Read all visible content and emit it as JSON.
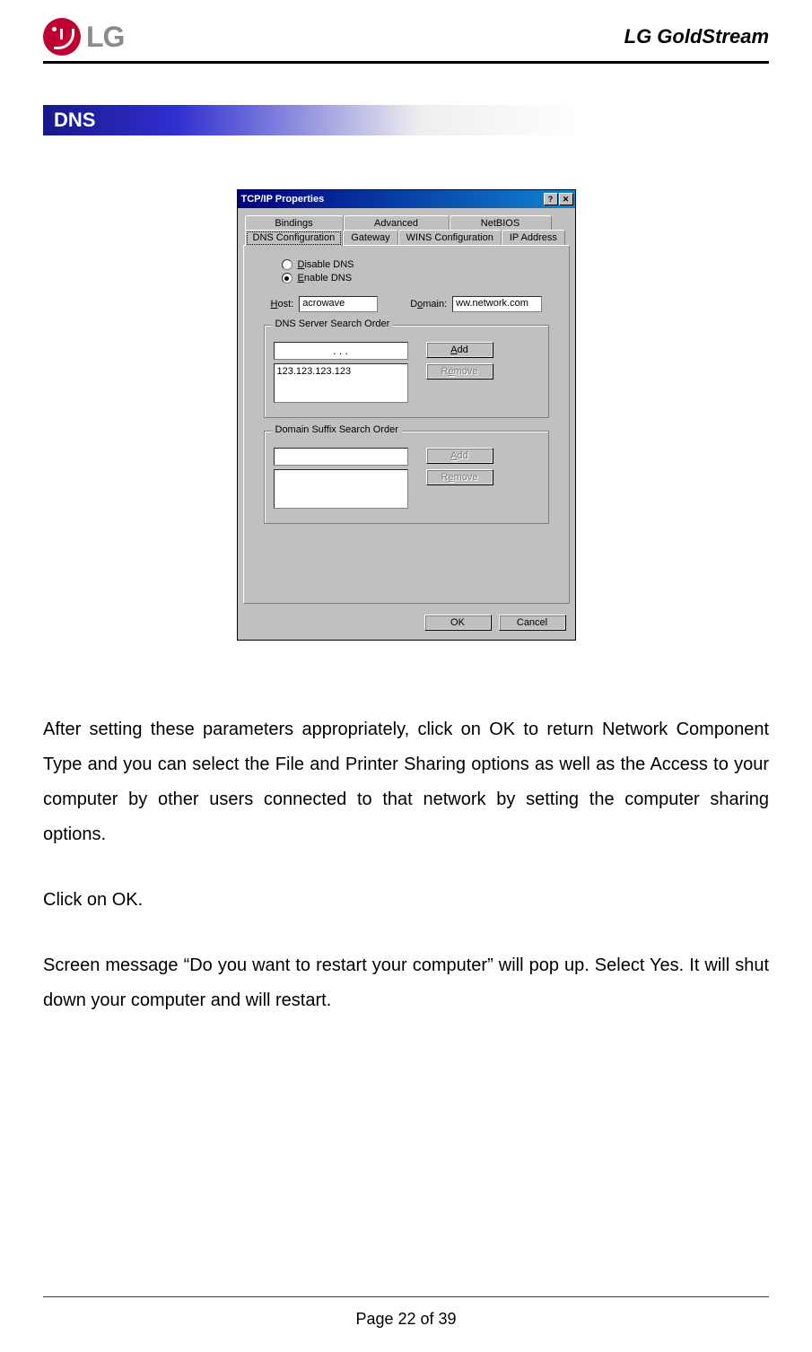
{
  "header": {
    "logo_text": "LG",
    "product": "LG GoldStream"
  },
  "section_title": "DNS",
  "dialog": {
    "title": "TCP/IP Properties",
    "help_btn": "?",
    "close_btn": "✕",
    "tabs_back": [
      "Bindings",
      "Advanced",
      "NetBIOS"
    ],
    "tabs_front": [
      "DNS Configuration",
      "Gateway",
      "WINS Configuration",
      "IP Address"
    ],
    "active_tab": "DNS Configuration",
    "disable_dns_label_pre": "D",
    "disable_dns_label_post": "isable DNS",
    "enable_dns_label_pre": "E",
    "enable_dns_label_post": "nable DNS",
    "host_label_pre": "H",
    "host_label_post": "ost:",
    "host_value": "acrowave",
    "domain_label_pre": "D",
    "domain_label_mid": "o",
    "domain_label_post": "main:",
    "domain_value": "ww.network.com",
    "dns_group": "DNS Server Search Order",
    "ip_dots": ".   .   .",
    "dns_list_item": "123.123.123.123",
    "suffix_group": "Domain Suffix Search Order",
    "add_btn_pre": "A",
    "add_btn_post": "dd",
    "remove_btn_pre": "R",
    "remove_btn_mid": "e",
    "remove_btn_post": "move",
    "ok": "OK",
    "cancel": "Cancel"
  },
  "body": {
    "p1": "After setting these parameters appropriately, click on OK to return Network Component Type and you can select the File and Printer Sharing options as well as the Access to your computer by other users connected to that network by setting the computer sharing options.",
    "p2": "Click on OK.",
    "p3": "Screen message “Do you want to restart your computer” will pop up. Select Yes. It will shut down your computer and will restart."
  },
  "footer": "Page 22 of 39"
}
